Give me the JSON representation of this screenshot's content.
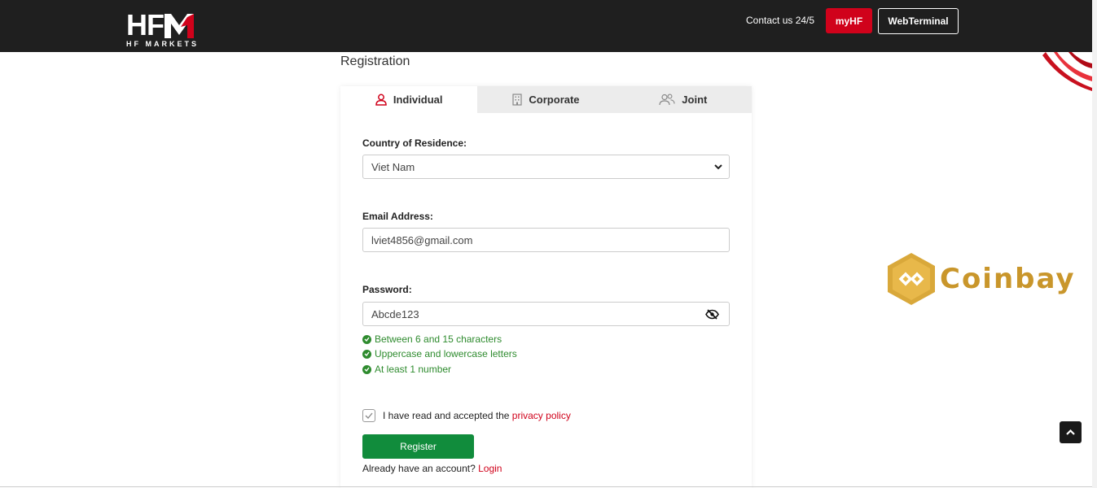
{
  "header": {
    "logo_main": "HF",
    "logo_sub": "HF MARKETS",
    "contact_label": "Contact us 24/5",
    "myhf_label": "myHF",
    "webterminal_label": "WebTerminal"
  },
  "page": {
    "title": "Registration"
  },
  "tabs": [
    {
      "label": "Individual",
      "icon": "person-icon",
      "active": true
    },
    {
      "label": "Corporate",
      "icon": "building-icon",
      "active": false
    },
    {
      "label": "Joint",
      "icon": "group-icon",
      "active": false
    }
  ],
  "form": {
    "country_label": "Country of Residence:",
    "country_value": "Viet Nam",
    "email_label": "Email Address:",
    "email_value": "lviet4856@gmail.com",
    "password_label": "Password:",
    "password_value": "Abcde123",
    "rules": [
      "Between 6 and 15 characters",
      "Uppercase and lowercase letters",
      "At least 1 number"
    ],
    "agree_text": "I have read and accepted the ",
    "privacy_link": "privacy policy",
    "agree_checked": true,
    "register_label": "Register",
    "already_text": "Already have an account? ",
    "login_link": "Login"
  },
  "watermark": {
    "text": "Coinbay"
  },
  "colors": {
    "brand_red": "#d0021b",
    "register_green": "#118c3c",
    "rule_green": "#2e8b2e",
    "topbar": "#1f1f1f",
    "coinbay_gold": "#c9962b"
  }
}
